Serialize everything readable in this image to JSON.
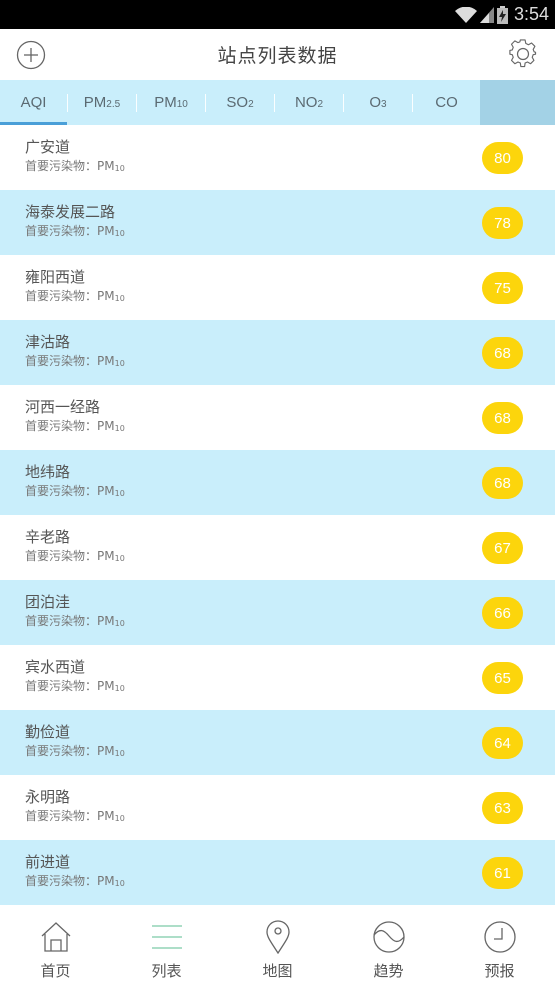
{
  "status_bar": {
    "time": "3:54",
    "icons": [
      "wifi-icon",
      "signal-icon",
      "battery-charging-icon"
    ]
  },
  "header": {
    "title": "站点列表数据",
    "left_icon": "add-circle-icon",
    "right_icon": "gear-icon"
  },
  "tabs": [
    {
      "main": "AQI",
      "sub": "",
      "active": true
    },
    {
      "main": "PM",
      "sub": "2.5",
      "active": false
    },
    {
      "main": "PM",
      "sub": "10",
      "active": false
    },
    {
      "main": "SO",
      "sub": "2",
      "active": false
    },
    {
      "main": "NO",
      "sub": "2",
      "active": false
    },
    {
      "main": "O",
      "sub": "3",
      "active": false
    },
    {
      "main": "CO",
      "sub": "",
      "active": false
    }
  ],
  "colors": {
    "row_alt": "#c9eefb",
    "badge": "#fcd50c",
    "tab_active_underline": "#4a9fd8",
    "tab_extra": "#a3d2e6"
  },
  "list": {
    "pollutant_label": "首要污染物：",
    "pollutant_main": "PM",
    "pollutant_sub": "10",
    "stations": [
      {
        "name": "广安道",
        "value": "80"
      },
      {
        "name": "海泰发展二路",
        "value": "78"
      },
      {
        "name": "雍阳西道",
        "value": "75"
      },
      {
        "name": "津沽路",
        "value": "68"
      },
      {
        "name": "河西一经路",
        "value": "68"
      },
      {
        "name": "地纬路",
        "value": "68"
      },
      {
        "name": "辛老路",
        "value": "67"
      },
      {
        "name": "团泊洼",
        "value": "66"
      },
      {
        "name": "宾水西道",
        "value": "65"
      },
      {
        "name": "勤俭道",
        "value": "64"
      },
      {
        "name": "永明路",
        "value": "63"
      },
      {
        "name": "前进道",
        "value": "61"
      }
    ]
  },
  "bottom_nav": [
    {
      "label": "首页",
      "icon": "home-icon",
      "active": false
    },
    {
      "label": "列表",
      "icon": "list-icon",
      "active": true
    },
    {
      "label": "地图",
      "icon": "map-pin-icon",
      "active": false
    },
    {
      "label": "趋势",
      "icon": "trend-wave-icon",
      "active": false
    },
    {
      "label": "预报",
      "icon": "clock-icon",
      "active": false
    }
  ]
}
